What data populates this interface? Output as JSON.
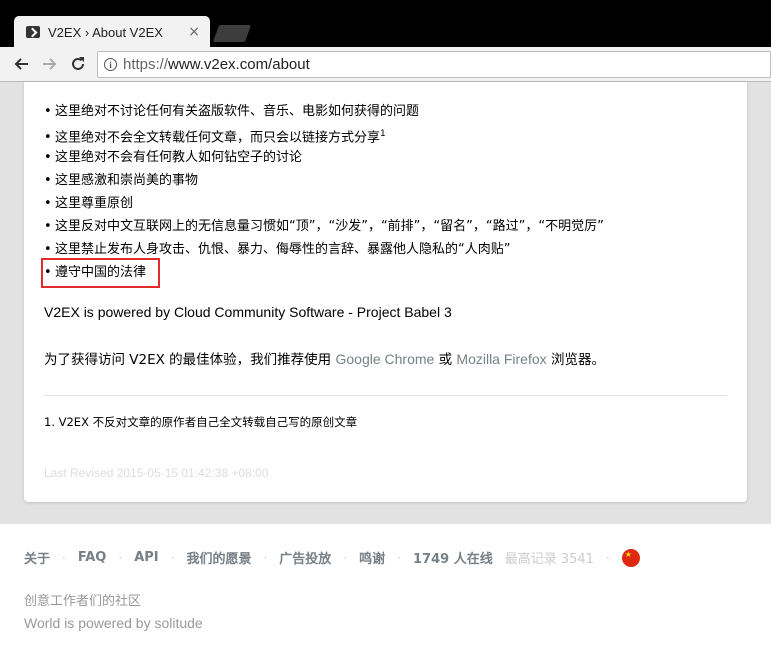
{
  "browser": {
    "tab_title": "V2EX › About V2EX",
    "tab_close": "×",
    "url_proto": "https://",
    "url_rest": "www.v2ex.com/about"
  },
  "rules": [
    "这里绝对不讨论任何有关盗版软件、音乐、电影如何获得的问题",
    "这里绝对不会全文转载任何文章，而只会以链接方式分享",
    "这里绝对不会有任何教人如何钻空子的讨论",
    "这里感激和崇尚美的事物",
    "这里尊重原创",
    "这里反对中文互联网上的无信息量习惯如“顶”，“沙发”，“前排”，“留名”，“路过”，“不明觉厉”",
    "这里禁止发布人身攻击、仇恨、暴力、侮辱性的言辞、暴露他人隐私的“人肉贴”",
    "遵守中国的法律"
  ],
  "rule_footnote_mark": "1",
  "bullet": "•",
  "powered_text": "V2EX is powered by Cloud Community Software - Project Babel 3",
  "recommend": {
    "prefix": "为了获得访问 V2EX 的最佳体验，我们推荐使用 ",
    "chrome": "Google Chrome",
    "or": " 或 ",
    "firefox": "Mozilla Firefox",
    "suffix": " 浏览器。"
  },
  "footnote": "1. V2EX 不反对文章的原作者自己全文转载自己写的原创文章",
  "last_revised": "Last Revised 2015-05-15 01:42:38 +08:00",
  "footer": {
    "links": [
      "关于",
      "FAQ",
      "API",
      "我们的愿景",
      "广告投放",
      "鸣谢"
    ],
    "online": "1749 人在线",
    "record": "最高记录 3541",
    "slogan": "创意工作者们的社区",
    "powered": "World is powered by solitude"
  }
}
